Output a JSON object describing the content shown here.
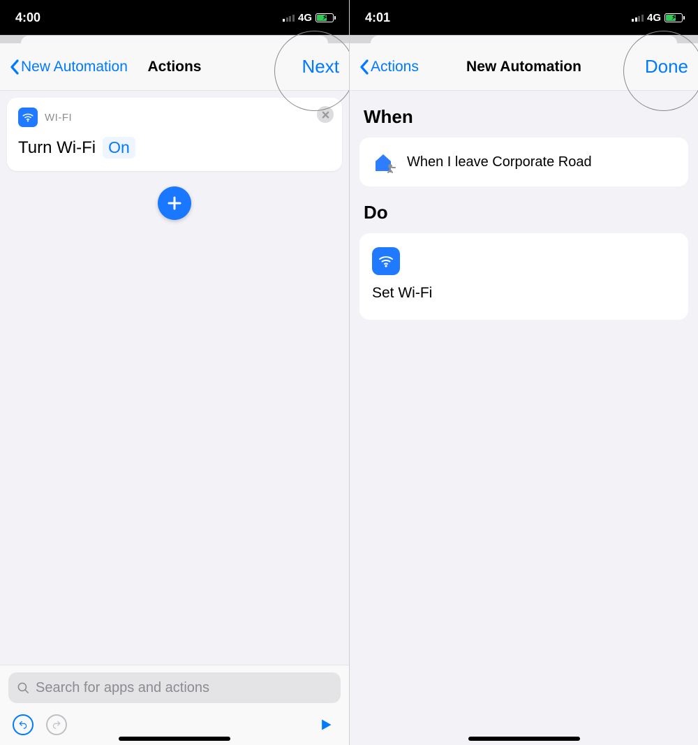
{
  "left": {
    "status": {
      "time": "4:00",
      "network": "4G"
    },
    "nav": {
      "back": "New Automation",
      "title": "Actions",
      "action": "Next"
    },
    "action_card": {
      "category": "WI-FI",
      "text": "Turn Wi-Fi",
      "param": "On"
    },
    "search_placeholder": "Search for apps and actions"
  },
  "right": {
    "status": {
      "time": "4:01",
      "network": "4G"
    },
    "nav": {
      "back": "Actions",
      "title": "New Automation",
      "action": "Done"
    },
    "sections": {
      "when_title": "When",
      "when_text": "When I leave Corporate Road",
      "do_title": "Do",
      "do_text": "Set Wi-Fi"
    }
  }
}
